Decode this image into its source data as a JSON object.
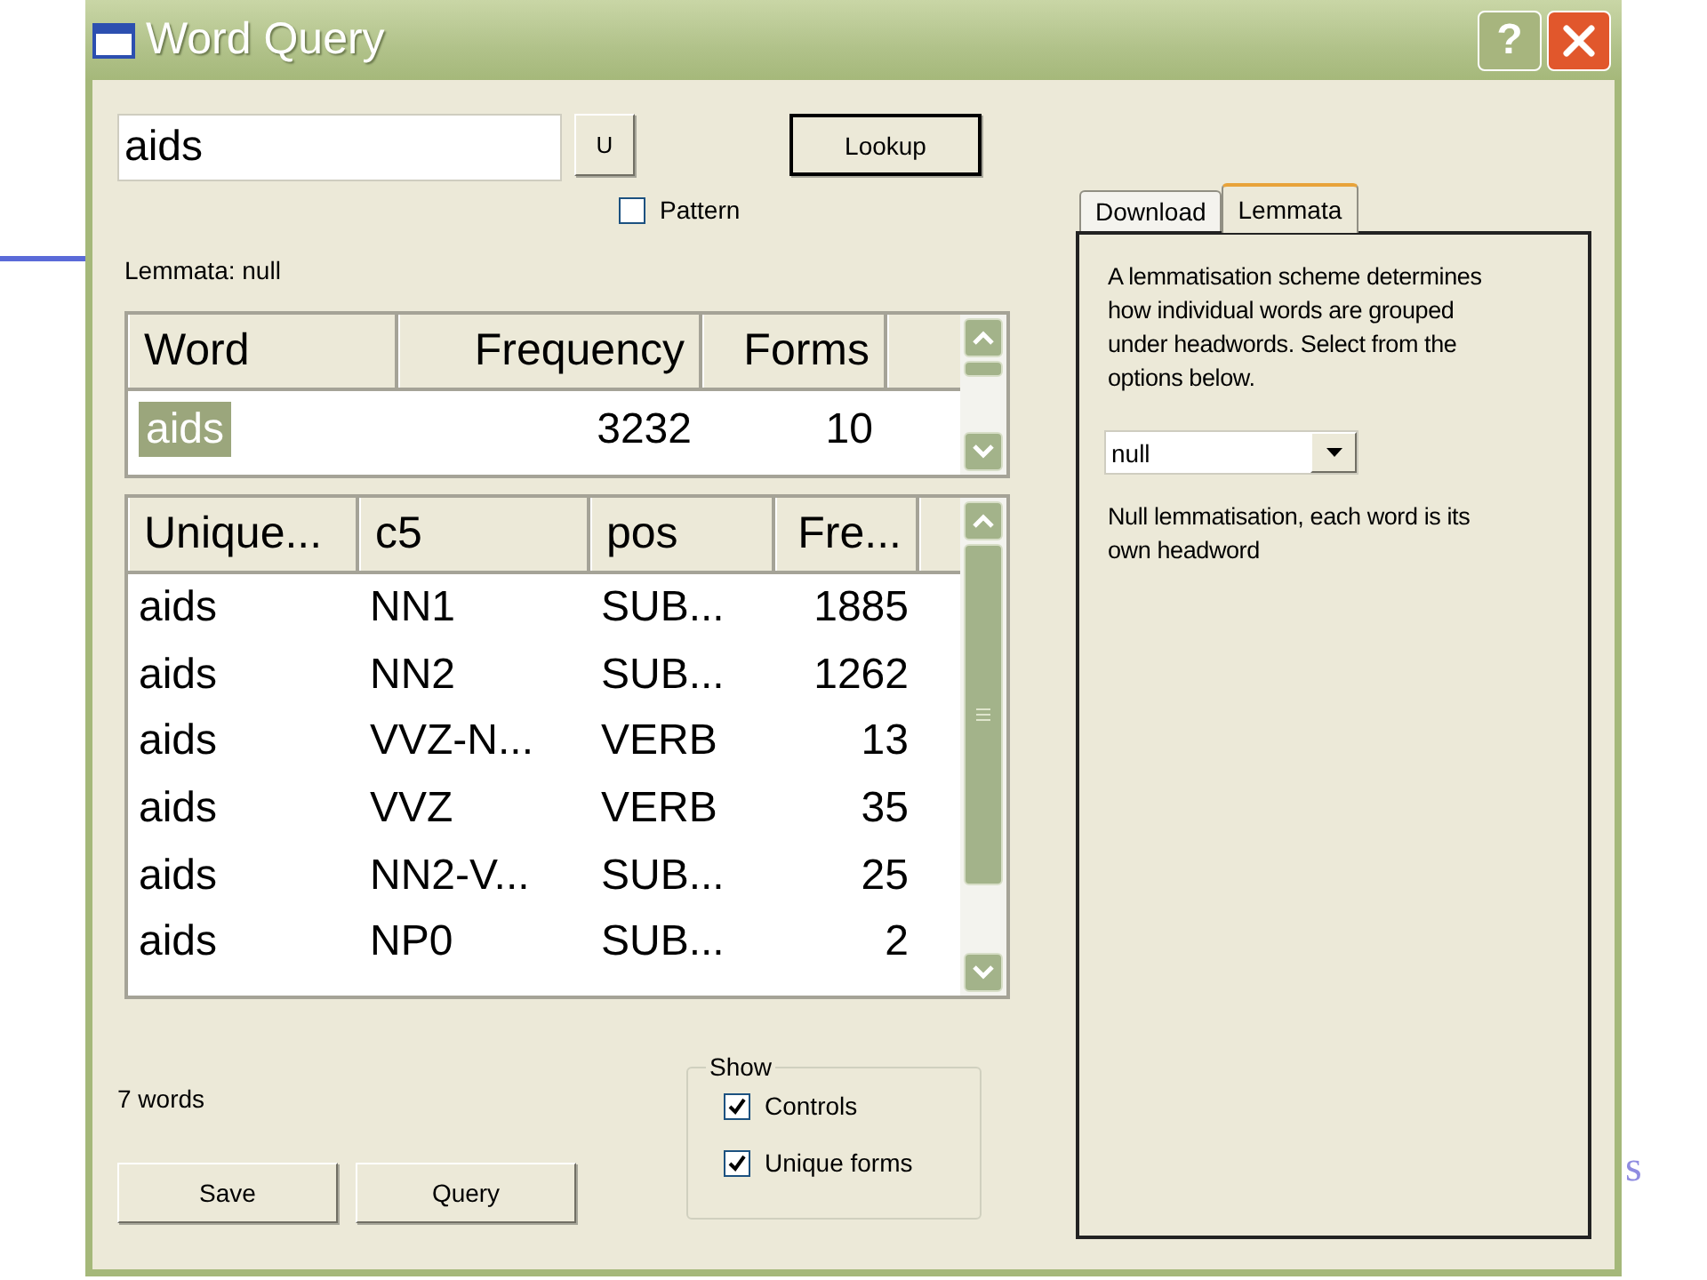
{
  "window": {
    "title": "Word Query",
    "help_button": "?"
  },
  "query": {
    "value": "aids"
  },
  "u_button": "U",
  "lookup_button": "Lookup",
  "pattern": {
    "label": "Pattern",
    "checked": false
  },
  "lemmata_status": "Lemmata: null",
  "word_table": {
    "columns": [
      "Word",
      "Frequency",
      "Forms"
    ],
    "rows": [
      {
        "cells": [
          "aids",
          "3232",
          "10"
        ],
        "selected": true
      }
    ]
  },
  "forms_table": {
    "columns": [
      "Unique...",
      "c5",
      "pos",
      "Fre..."
    ],
    "rows": [
      {
        "cells": [
          "aids",
          "NN1",
          "SUB...",
          "1885"
        ]
      },
      {
        "cells": [
          "aids",
          "NN2",
          "SUB...",
          "1262"
        ]
      },
      {
        "cells": [
          "aids",
          "VVZ-N...",
          "VERB",
          "13"
        ]
      },
      {
        "cells": [
          "aids",
          "VVZ",
          "VERB",
          "35"
        ]
      },
      {
        "cells": [
          "aids",
          "NN2-V...",
          "SUB...",
          "25"
        ]
      },
      {
        "cells": [
          "aids",
          "NP0",
          "SUB...",
          "2"
        ]
      }
    ]
  },
  "word_count": "7 words",
  "buttons": [
    "Save",
    "Query"
  ],
  "show_group": {
    "title": "Show",
    "options": [
      {
        "label": "Controls",
        "checked": true
      },
      {
        "label": "Unique forms",
        "checked": true
      }
    ]
  },
  "tabs": [
    {
      "label": "Download",
      "selected": false
    },
    {
      "label": "Lemmata",
      "selected": true
    }
  ],
  "lemmata_panel": {
    "description": "A lemmatisation scheme determines how individual words are grouped under headwords. Select from the options below.",
    "dropdown": {
      "value": "null"
    },
    "note": "Null lemmatisation, each word is its own headword"
  },
  "background_fragment": "s"
}
